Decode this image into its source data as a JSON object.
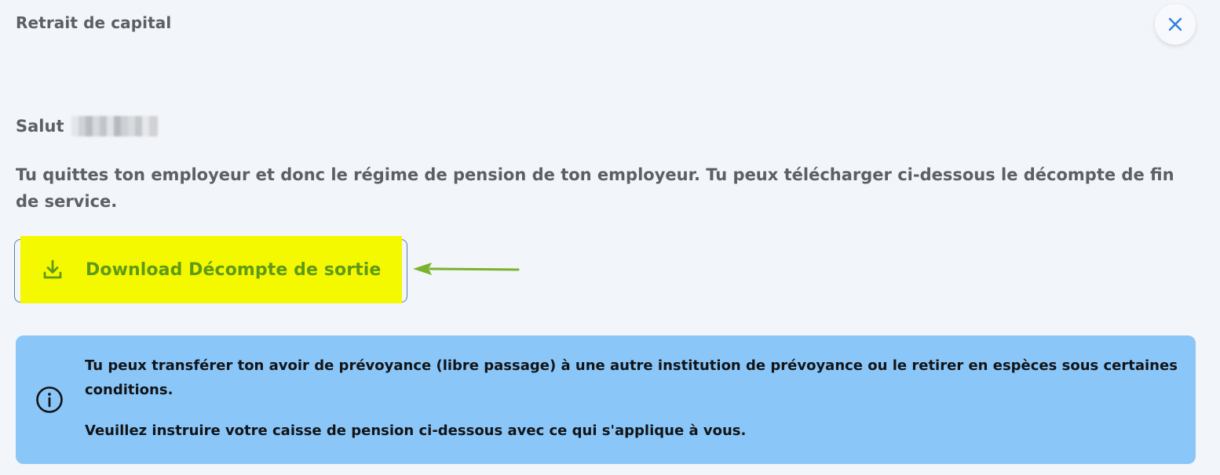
{
  "modal": {
    "title": "Retrait de capital",
    "close_icon": "close-icon"
  },
  "greeting": {
    "salutation": "Salut"
  },
  "intro": {
    "text": "Tu quittes ton employeur et donc le régime de pension de ton employeur. Tu peux télécharger ci-dessous le décompte de fin de service."
  },
  "download": {
    "label": "Download Décompte de sortie",
    "icon": "download-icon",
    "highlight_color": "#f5f900",
    "label_color": "#5f9a16"
  },
  "info": {
    "icon": "info-icon",
    "text_1": "Tu peux transférer ton avoir de prévoyance (libre passage) à une autre institution de prévoyance ou le retirer en espèces sous certaines conditions.",
    "text_2": "Veuillez instruire votre caisse de pension ci-dessous avec ce qui s'applique à vous.",
    "background_color": "#8ac6f8"
  },
  "colors": {
    "background": "#f2f5f9",
    "accent": "#2f7fe0",
    "text_muted": "#5b5f66",
    "annotation_arrow": "#7ab32e"
  }
}
